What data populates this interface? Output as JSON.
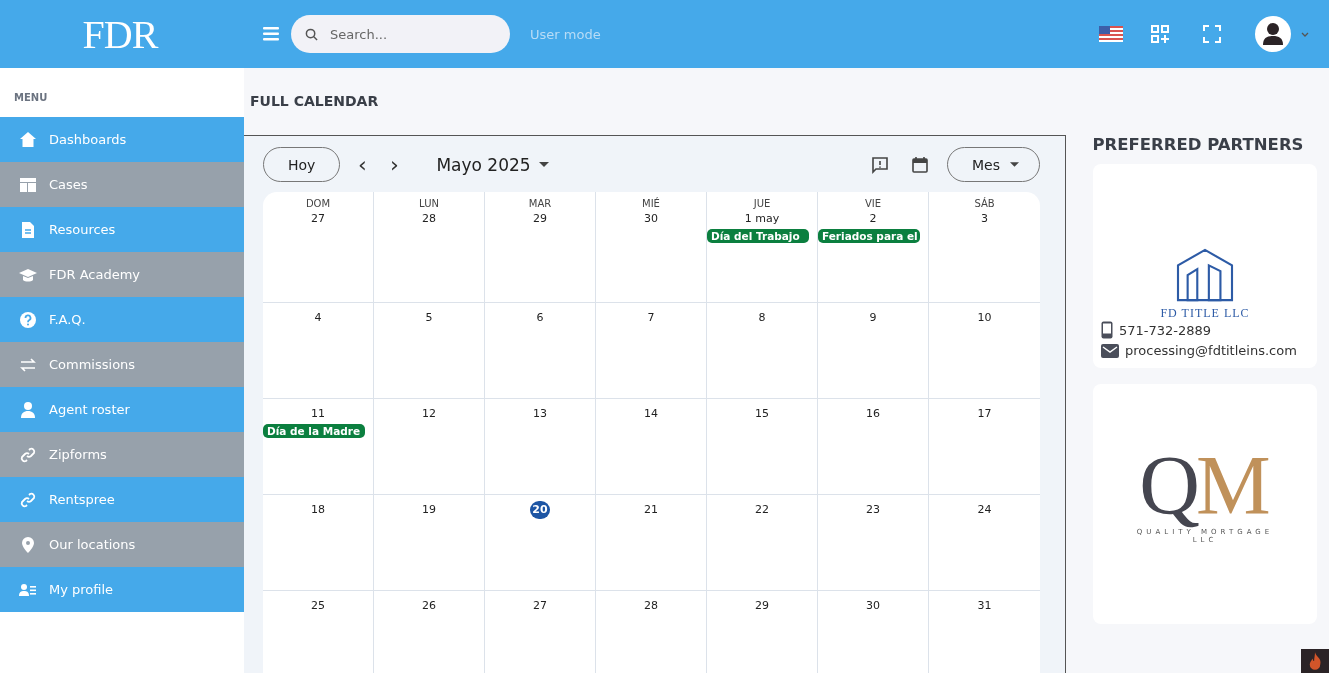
{
  "header": {
    "logo": "FDR",
    "search": {
      "placeholder": "Search..."
    },
    "mode_label": "User mode"
  },
  "sidebar": {
    "heading": "MENU",
    "items": [
      {
        "label": "Dashboards"
      },
      {
        "label": "Cases"
      },
      {
        "label": "Resources"
      },
      {
        "label": "FDR Academy"
      },
      {
        "label": "F.A.Q."
      },
      {
        "label": "Commissions"
      },
      {
        "label": "Agent roster"
      },
      {
        "label": "Zipforms"
      },
      {
        "label": "Rentspree"
      },
      {
        "label": "Our locations"
      },
      {
        "label": "My profile"
      }
    ]
  },
  "page_title": "FULL CALENDAR",
  "calendar": {
    "today_button": "Hoy",
    "prev": "‹",
    "next": "›",
    "month": "Mayo 2025",
    "view": "Mes",
    "weekdays": [
      "DOM",
      "LUN",
      "MAR",
      "MIÉ",
      "JUE",
      "VIE",
      "SÁB"
    ],
    "weeks": [
      [
        {
          "day": "27",
          "today": false
        },
        {
          "day": "28",
          "today": false
        },
        {
          "day": "29",
          "today": false
        },
        {
          "day": "30",
          "today": false
        },
        {
          "day": "1 may",
          "today": false,
          "events": [
            "Día del Trabajo"
          ]
        },
        {
          "day": "2",
          "today": false,
          "events": [
            "Feriados para el"
          ]
        },
        {
          "day": "3",
          "today": false
        }
      ],
      [
        {
          "day": "4",
          "today": false
        },
        {
          "day": "5",
          "today": false
        },
        {
          "day": "6",
          "today": false
        },
        {
          "day": "7",
          "today": false
        },
        {
          "day": "8",
          "today": false
        },
        {
          "day": "9",
          "today": false
        },
        {
          "day": "10",
          "today": false
        }
      ],
      [
        {
          "day": "11",
          "today": false,
          "events": [
            "Día de la Madre"
          ]
        },
        {
          "day": "12",
          "today": false
        },
        {
          "day": "13",
          "today": false
        },
        {
          "day": "14",
          "today": false
        },
        {
          "day": "15",
          "today": false
        },
        {
          "day": "16",
          "today": false
        },
        {
          "day": "17",
          "today": false
        }
      ],
      [
        {
          "day": "18",
          "today": false
        },
        {
          "day": "19",
          "today": false
        },
        {
          "day": "20",
          "today": true
        },
        {
          "day": "21",
          "today": false
        },
        {
          "day": "22",
          "today": false
        },
        {
          "day": "23",
          "today": false
        },
        {
          "day": "24",
          "today": false
        }
      ],
      [
        {
          "day": "25",
          "today": false
        },
        {
          "day": "26",
          "today": false
        },
        {
          "day": "27",
          "today": false
        },
        {
          "day": "28",
          "today": false
        },
        {
          "day": "29",
          "today": false
        },
        {
          "day": "30",
          "today": false
        },
        {
          "day": "31",
          "today": false
        }
      ]
    ]
  },
  "partners": {
    "heading": "PREFERRED PARTNERS",
    "cards": [
      {
        "kind": "title",
        "logo_text": "FD TITLE LLC",
        "phone": "571-732-2889",
        "email": "processing@fdtitleins.com"
      },
      {
        "kind": "qm",
        "logo_letters": [
          "Q",
          "M"
        ],
        "logo_text": "QUALITY MORTGAGE",
        "logo_subtext": "LLC"
      }
    ]
  }
}
